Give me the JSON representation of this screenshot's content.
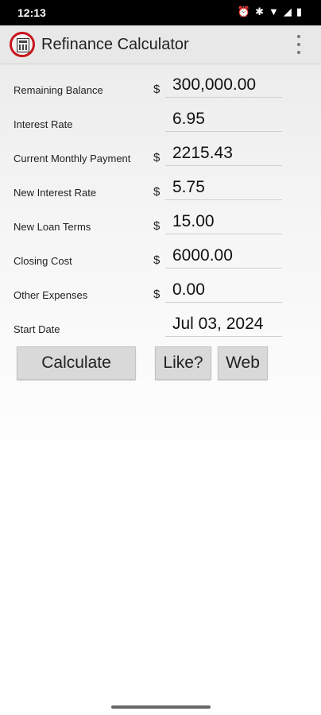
{
  "status_bar": {
    "time": "12:13",
    "icons": [
      "alarm-icon",
      "bluetooth-icon",
      "wifi-icon",
      "signal-icon",
      "battery-icon"
    ]
  },
  "app_bar": {
    "title": "Refinance Calculator",
    "icon": "calculator-icon",
    "menu_icon": "overflow-menu-icon"
  },
  "form": {
    "rows": [
      {
        "label": "Remaining Balance",
        "currency": "$",
        "value": "300,000.00"
      },
      {
        "label": "Interest Rate",
        "currency": "",
        "value": "6.95"
      },
      {
        "label": "Current Monthly Payment",
        "currency": "$",
        "value": "2215.43"
      },
      {
        "label": "New Interest Rate",
        "currency": "$",
        "value": "5.75"
      },
      {
        "label": "New Loan Terms",
        "currency": "$",
        "value": "15.00"
      },
      {
        "label": "Closing Cost",
        "currency": "$",
        "value": "6000.00"
      },
      {
        "label": "Other Expenses",
        "currency": "$",
        "value": "0.00"
      },
      {
        "label": "Start Date",
        "currency": "",
        "value": "Jul 03, 2024"
      }
    ]
  },
  "buttons": {
    "calculate": "Calculate",
    "like": "Like?",
    "web": "Web"
  }
}
